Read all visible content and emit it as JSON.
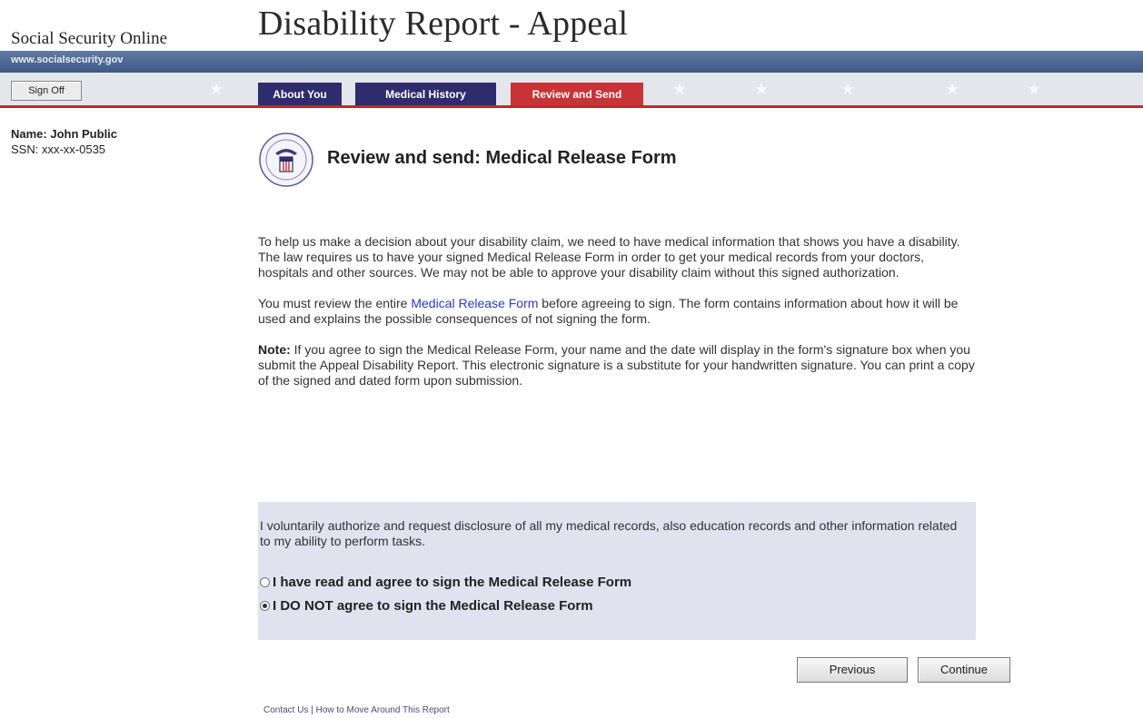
{
  "header": {
    "site_name": "Social Security Online",
    "app_title": "Disability Report - Appeal",
    "url": "www.socialsecurity.gov"
  },
  "nav": {
    "sign_off": "Sign Off",
    "tabs": [
      {
        "label": "About You",
        "state": "inactive"
      },
      {
        "label": "Medical History",
        "state": "inactive"
      },
      {
        "label": "Review and Send",
        "state": "active"
      }
    ]
  },
  "user": {
    "name": "Name: John Public",
    "ssn": "SSN: xxx-xx-0535"
  },
  "page": {
    "heading": "Review and send: Medical Release Form",
    "para1": "To help us make a decision about your disability claim, we need to have medical information that shows you have a disability. The law requires us to have your signed Medical Release Form in order to get your medical records from your doctors, hospitals and other sources. We may not be able to approve your disability claim without this signed authorization.",
    "para2_before": "You must review the entire ",
    "para2_link": "Medical Release Form",
    "para2_after": " before agreeing to sign. The form contains information about how it will be used and explains the possible consequences of not signing the form.",
    "note_label": "Note:",
    "note_text": " If you agree to sign the Medical Release Form, your name and the date will display in the form's signature box when you submit the Appeal Disability Report. This electronic signature is a substitute for your handwritten signature. You can print a copy of the signed and dated form upon submission."
  },
  "authorization": {
    "text": "I voluntarily authorize and request disclosure of all my medical records, also education records and other information related to my ability to perform tasks.",
    "options": [
      {
        "label": "I have read and agree to sign the Medical Release Form",
        "checked": false
      },
      {
        "label": "I DO NOT agree to sign the Medical Release Form",
        "checked": true
      }
    ]
  },
  "buttons": {
    "previous": "Previous",
    "continue": "Continue"
  },
  "footer": {
    "contact": "Contact Us",
    "separator": " | ",
    "how_to": "How to Move Around This Report"
  },
  "colors": {
    "tab_inactive": "#2d2d6e",
    "tab_active": "#c83337",
    "auth_box_bg": "#e1e1ef",
    "link": "#2a3ac9"
  }
}
